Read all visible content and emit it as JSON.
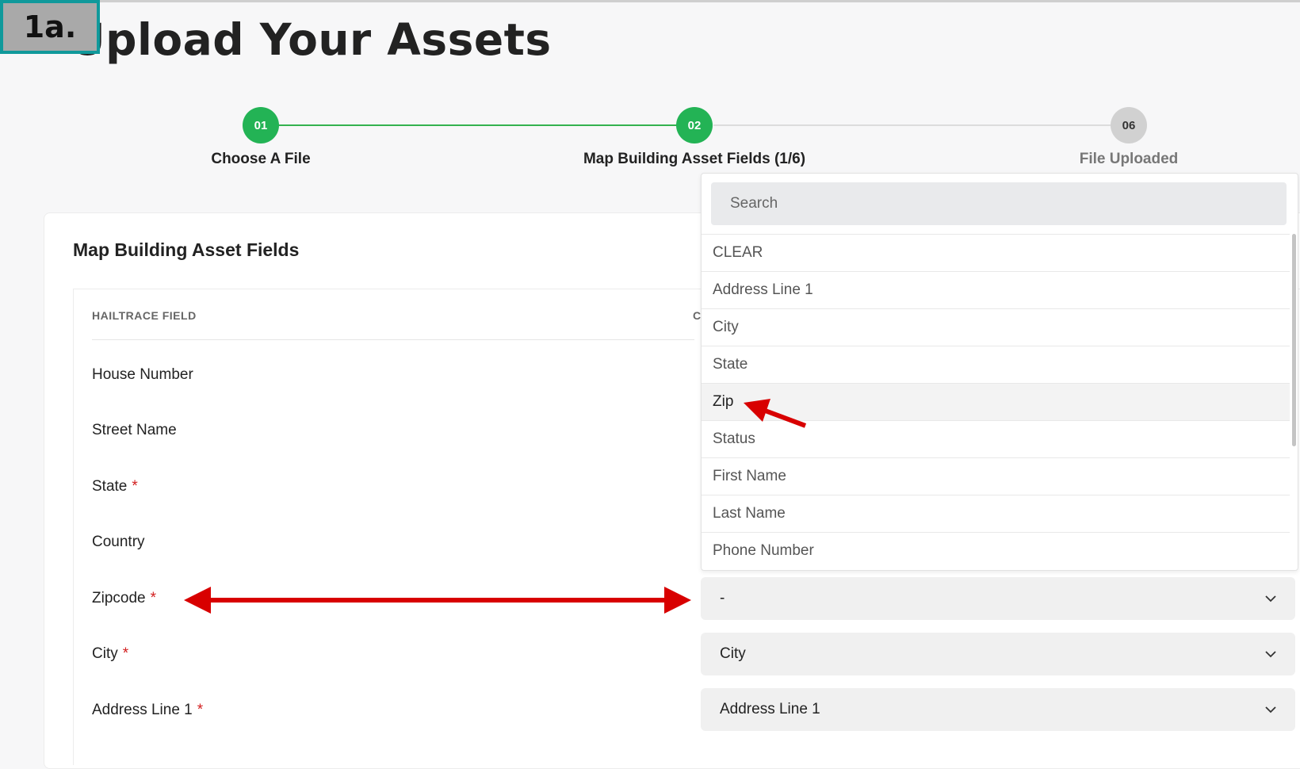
{
  "badge": "1a.",
  "page_title": "Upload Your Assets",
  "stepper": [
    {
      "number": "01",
      "label": "Choose A File",
      "state": "done"
    },
    {
      "number": "02",
      "label": "Map Building Asset Fields (1/6)",
      "state": "done"
    },
    {
      "number": "06",
      "label": "File Uploaded",
      "state": "pending"
    }
  ],
  "card": {
    "title": "Map Building Asset Fields",
    "column_header": "HAILTRACE FIELD",
    "column_header_2": "C",
    "required_mark": "*",
    "fields": [
      {
        "label": "House Number"
      },
      {
        "label": "Street Name"
      },
      {
        "label": "State"
      },
      {
        "label": "Country"
      },
      {
        "label": "Zipcode"
      },
      {
        "label": "City"
      },
      {
        "label": "Address Line 1"
      }
    ],
    "selects": [
      {
        "value": "-"
      },
      {
        "value": "City"
      },
      {
        "value": "Address Line 1"
      }
    ]
  },
  "dropdown": {
    "search_placeholder": "Search",
    "options": [
      "CLEAR",
      "Address Line 1",
      "City",
      "State",
      "Zip",
      "Status",
      "First Name",
      "Last Name",
      "Phone Number"
    ],
    "hovered_option": "Zip"
  },
  "colors": {
    "step_done": "#23b355",
    "step_pending": "#d1d1d1",
    "required": "#d21e1e",
    "annotation_arrow": "#d80000",
    "badge_border": "#10999b"
  }
}
